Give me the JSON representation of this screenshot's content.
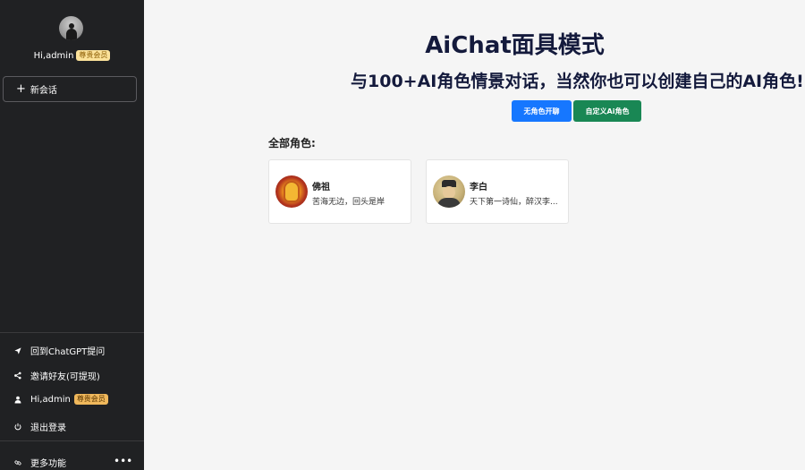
{
  "sidebar": {
    "user_greeting": "Hi,admin",
    "vip_label": "尊贵会员",
    "new_chat_label": "新会话",
    "bottom_items": [
      {
        "label": "回到ChatGPT提问",
        "icon": "send-icon"
      },
      {
        "label": "邀请好友(可提现)",
        "icon": "share-icon"
      },
      {
        "label": "Hi,admin",
        "icon": "user-icon",
        "badge": "尊贵会员"
      },
      {
        "label": "退出登录",
        "icon": "power-icon"
      }
    ],
    "more_label": "更多功能",
    "more_icon": "link-icon",
    "dots_icon": "more-dots-icon"
  },
  "main": {
    "title": "AiChat面具模式",
    "subtitle": "与100+AI角色情景对话，当然你也可以创建自己的AI角色!",
    "buttons": {
      "no_role": "无角色开聊",
      "custom_role": "自定义Ai角色"
    },
    "section_label": "全部角色:",
    "roles": [
      {
        "name": "佛祖",
        "desc": "苦海无边，回头是岸"
      },
      {
        "name": "李白",
        "desc": "天下第一诗仙，醉汉李..."
      }
    ]
  },
  "colors": {
    "sidebar_bg": "#202123",
    "main_bg": "#f5f5f5",
    "blue_button": "#1677ff",
    "green_button": "#198754",
    "title_color": "#141a3c",
    "vip_badge_bg": "#fbe29a"
  }
}
